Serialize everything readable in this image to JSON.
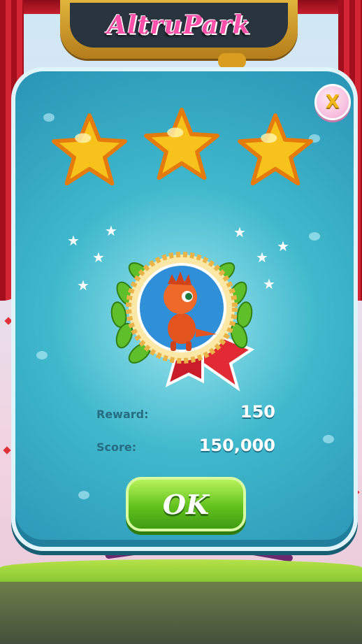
{
  "game": {
    "title": "AltruPark",
    "stars_earned": 3,
    "stars_total": 3,
    "reward_label": "Reward:",
    "reward_value": "150",
    "score_label": "Score:",
    "score_value": "150,000",
    "ok_label": "OK",
    "close_label": "X"
  },
  "colors": {
    "panel": "#3fb8cc",
    "star": "#f6c21b",
    "ok_button": "#62c21d",
    "title_text": "#ff4fa8"
  }
}
